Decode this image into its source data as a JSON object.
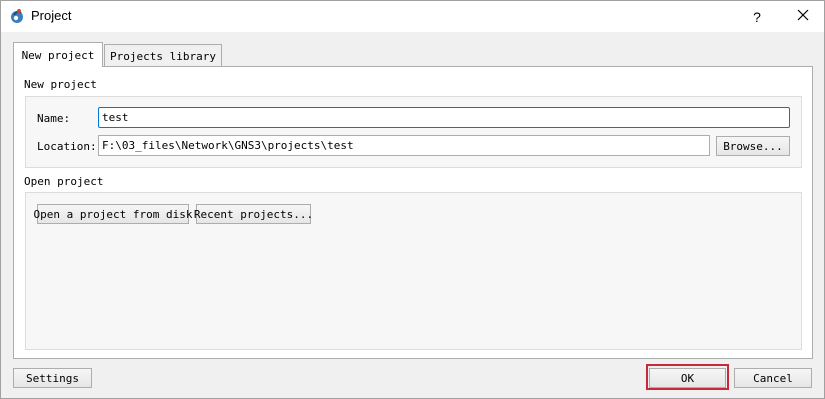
{
  "window": {
    "title": "Project",
    "help_label": "?",
    "icon": "gns3-app-icon",
    "close_icon": "close-icon"
  },
  "tabs": [
    {
      "label": "New project",
      "active": true
    },
    {
      "label": "Projects library",
      "active": false
    }
  ],
  "new_project": {
    "group_title": "New project",
    "name_label": "Name:",
    "name_value": "test",
    "location_label": "Location:",
    "location_value": "F:\\03_files\\Network\\GNS3\\projects\\test",
    "browse_label": "Browse..."
  },
  "open_project": {
    "group_title": "Open project",
    "open_from_disk_label": "Open a project from disk",
    "recent_projects_label": "Recent projects..."
  },
  "footer": {
    "settings_label": "Settings",
    "ok_label": "OK",
    "cancel_label": "Cancel"
  },
  "colors": {
    "highlight": "#c8283a",
    "focus": "#0078d7"
  }
}
